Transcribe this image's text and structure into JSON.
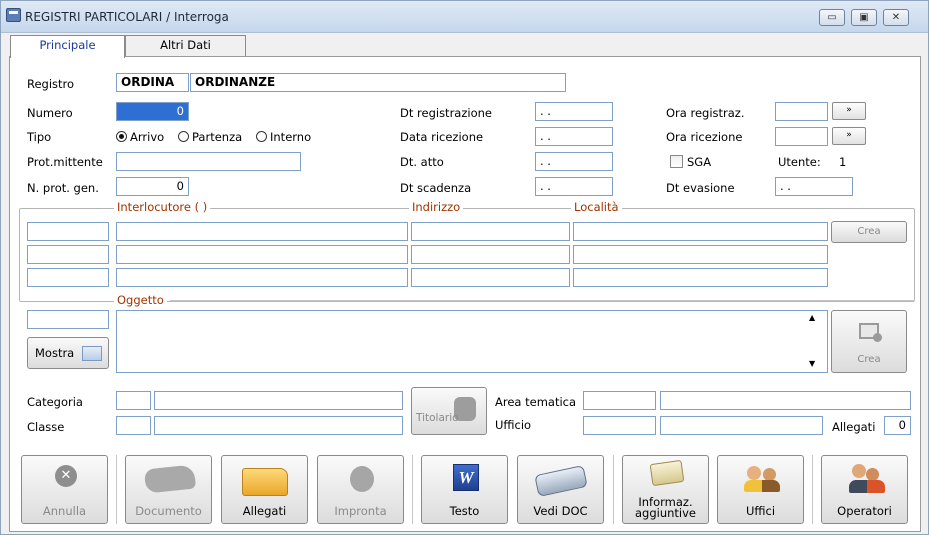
{
  "window": {
    "title": "REGISTRI PARTICOLARI / Interroga",
    "buttons": {
      "minimize": "▭",
      "maximize": "▣",
      "close": "✕"
    }
  },
  "tabs": [
    {
      "label": "Principale",
      "active": true
    },
    {
      "label": "Altri Dati",
      "active": false
    }
  ],
  "form": {
    "registro_label": "Registro",
    "registro_code": "ORDINA",
    "registro_desc": "ORDINANZE",
    "numero_label": "Numero",
    "numero_value": "0",
    "tipo_label": "Tipo",
    "tipo_options": [
      "Arrivo",
      "Partenza",
      "Interno"
    ],
    "tipo_selected": "Arrivo",
    "prot_mittente_label": "Prot.mittente",
    "prot_mittente_value": "",
    "nprot_label": "N. prot. gen.",
    "nprot_value": "0",
    "dt_registrazione_label": "Dt registrazione",
    "dt_registrazione_value": ". .",
    "data_ricezione_label": "Data ricezione",
    "data_ricezione_value": ". .",
    "dt_atto_label": "Dt. atto",
    "dt_atto_value": ". .",
    "dt_scadenza_label": "Dt scadenza",
    "dt_scadenza_value": ". .",
    "ora_registraz_label": "Ora registraz.",
    "ora_ricezione_label": "Ora ricezione",
    "ora_button": "»",
    "sga_label": "SGA",
    "utente_label": "Utente:",
    "utente_value": "1",
    "dt_evasione_label": "Dt evasione",
    "dt_evasione_value": ". ."
  },
  "interlocutore": {
    "title": "Interlocutore  (     )",
    "indirizzo_title": "Indirizzo",
    "localita_title": "Località",
    "crea_label": "Crea"
  },
  "oggetto": {
    "title": "Oggetto",
    "mostra_label": "Mostra",
    "crea_label": "Crea",
    "scroll_up": "▲",
    "scroll_down": "▼"
  },
  "classificazione": {
    "categoria_label": "Categoria",
    "classe_label": "Classe",
    "titolario_label": "Titolario",
    "area_tematica_label": "Area tematica",
    "ufficio_label": "Ufficio",
    "allegati_label": "Allegati",
    "allegati_value": "0"
  },
  "toolbar": [
    {
      "label": "Annulla",
      "icon": "cancel-icon",
      "enabled": false
    },
    {
      "label": "Documento",
      "icon": "document-icon",
      "enabled": false
    },
    {
      "label": "Allegati",
      "icon": "folder-icon",
      "enabled": true
    },
    {
      "label": "Impronta",
      "icon": "fingerprint-icon",
      "enabled": false
    },
    {
      "label": "Testo",
      "icon": "word-icon",
      "enabled": true
    },
    {
      "label": "Vedi DOC",
      "icon": "scanner-icon",
      "enabled": true
    },
    {
      "label": "Informaz.\naggiuntive",
      "icon": "book-icon",
      "enabled": true
    },
    {
      "label": "Uffici",
      "icon": "users-icon",
      "enabled": true
    },
    {
      "label": "Operatori",
      "icon": "operators-icon",
      "enabled": true
    }
  ]
}
